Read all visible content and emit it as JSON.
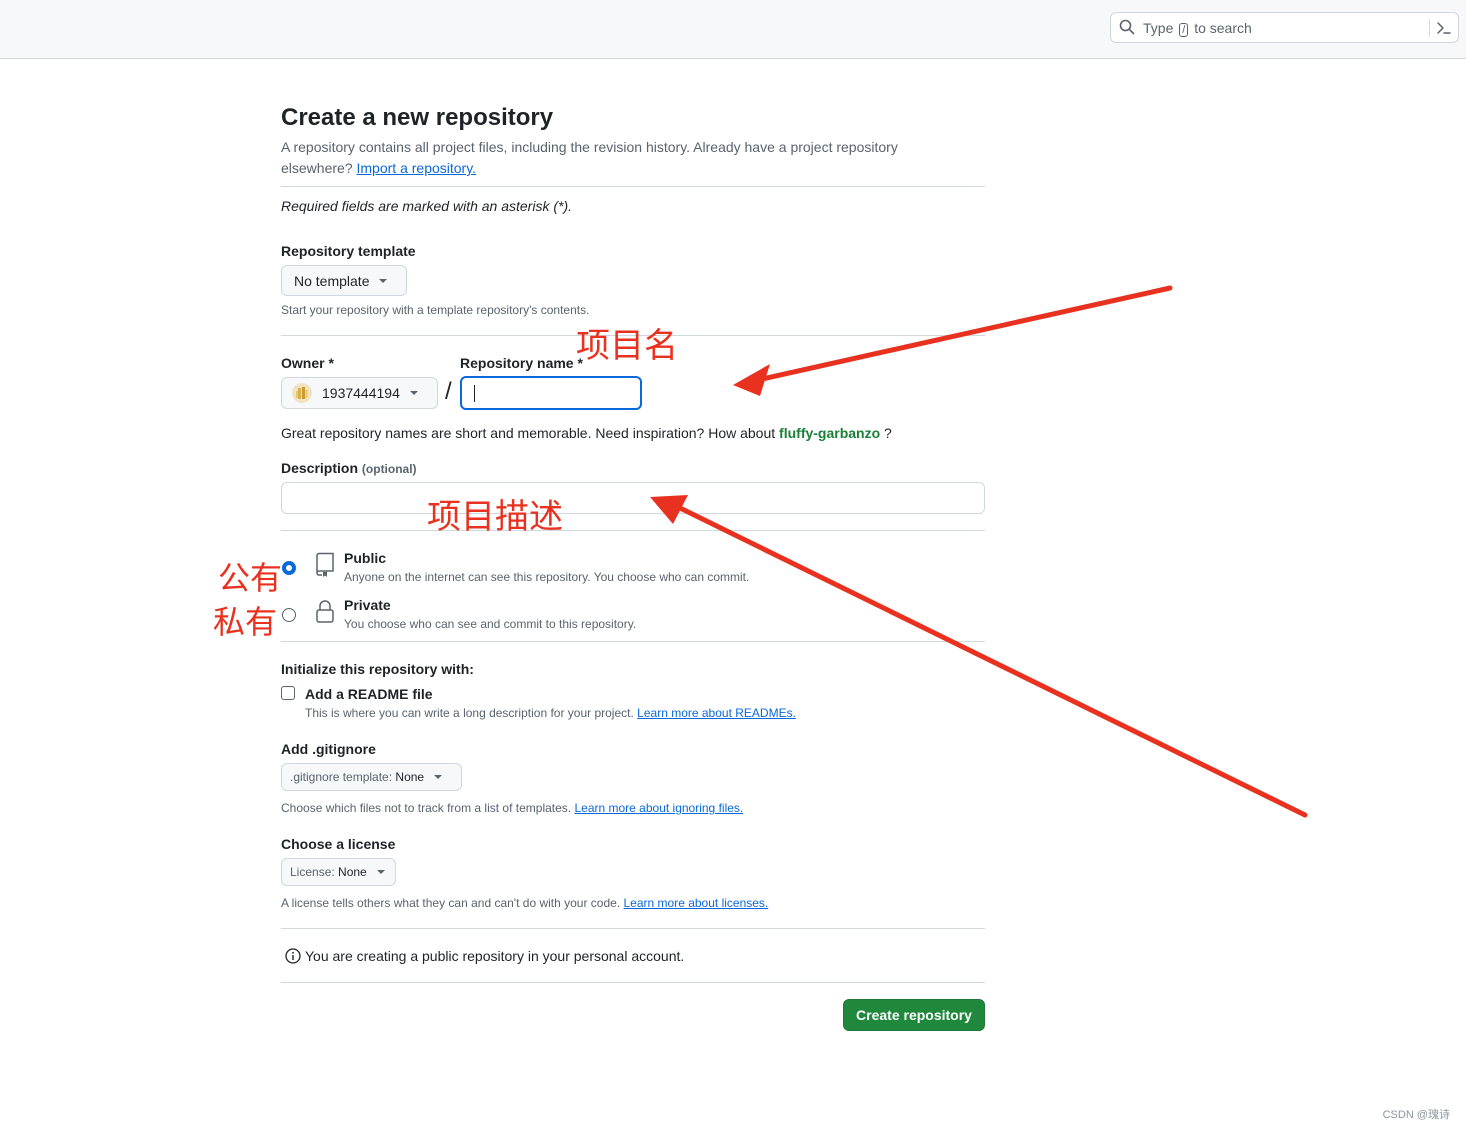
{
  "header": {
    "search": {
      "prefix": "Type",
      "key": "/",
      "suffix": "to search"
    }
  },
  "page": {
    "title": "Create a new repository",
    "intro_text": "A repository contains all project files, including the revision history. Already have a project repository elsewhere?",
    "import_link": "Import a repository.",
    "required_note": "Required fields are marked with an asterisk (*)."
  },
  "template": {
    "label": "Repository template",
    "value": "No template",
    "note": "Start your repository with a template repository's contents."
  },
  "owner": {
    "label": "Owner *",
    "value": "1937444194"
  },
  "repo_name": {
    "label": "Repository name *",
    "value": "",
    "slash": "/",
    "hint_text": "Great repository names are short and memorable. Need inspiration? How about",
    "suggestion": "fluffy-garbanzo",
    "hint_end": "?"
  },
  "description": {
    "label": "Description",
    "optional": "(optional)",
    "value": ""
  },
  "visibility": {
    "options": [
      {
        "title": "Public",
        "desc": "Anyone on the internet can see this repository. You choose who can commit.",
        "checked": true
      },
      {
        "title": "Private",
        "desc": "You choose who can see and commit to this repository.",
        "checked": false
      }
    ]
  },
  "init": {
    "heading": "Initialize this repository with:",
    "readme_title": "Add a README file",
    "readme_desc": "This is where you can write a long description for your project.",
    "readme_link": "Learn more about READMEs."
  },
  "gitignore": {
    "label": "Add .gitignore",
    "button_prefix": ".gitignore template:",
    "button_value": "None",
    "note": "Choose which files not to track from a list of templates.",
    "link": "Learn more about ignoring files."
  },
  "license": {
    "label": "Choose a license",
    "button_prefix": "License:",
    "button_value": "None",
    "note": "A license tells others what they can and can't do with your code.",
    "link": "Learn more about licenses."
  },
  "info_text": "You are creating a public repository in your personal account.",
  "create_button": "Create repository",
  "annotations": {
    "repo_name": "项目名",
    "description": "项目描述",
    "public": "公有",
    "private": "私有"
  },
  "watermark": "CSDN @瑰诗",
  "colors": {
    "accent": "#0969da",
    "primary_button": "#1f883d",
    "annotation": "#e8321f",
    "suggestion": "#1a7f37"
  }
}
